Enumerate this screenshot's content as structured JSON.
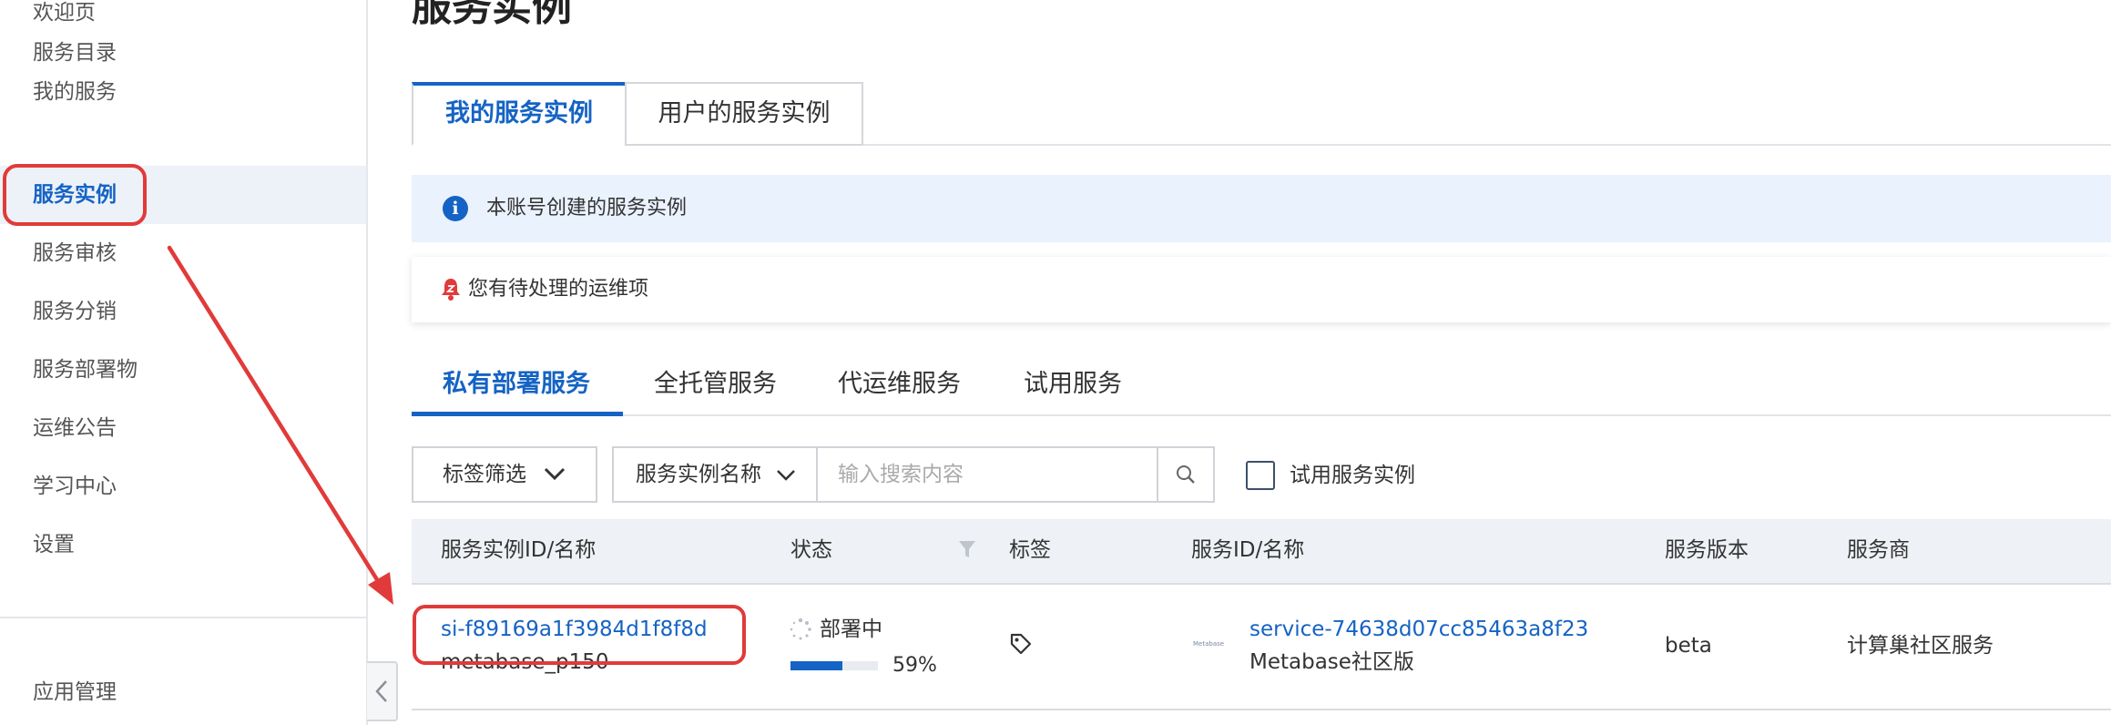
{
  "sidebar": {
    "items": [
      {
        "label": "欢迎页"
      },
      {
        "label": "服务目录"
      },
      {
        "label": "我的服务"
      },
      {
        "label": "服务实例",
        "active": true
      },
      {
        "label": "服务审核"
      },
      {
        "label": "服务分销"
      },
      {
        "label": "服务部署物"
      },
      {
        "label": "运维公告"
      },
      {
        "label": "学习中心"
      },
      {
        "label": "设置"
      }
    ],
    "bottom_item": "应用管理",
    "collapse_icon": "chevron-left-icon"
  },
  "page": {
    "title": "服务实例"
  },
  "top_tabs": [
    {
      "label": "我的服务实例",
      "active": true
    },
    {
      "label": "用户的服务实例"
    }
  ],
  "info_banner": {
    "icon": "info-icon",
    "icon_glyph": "i",
    "text": "本账号创建的服务实例"
  },
  "pending_notice": {
    "icon": "bell-icon",
    "text": "您有待处理的运维项"
  },
  "sub_tabs": [
    {
      "label": "私有部署服务",
      "active": true
    },
    {
      "label": "全托管服务"
    },
    {
      "label": "代运维服务"
    },
    {
      "label": "试用服务"
    }
  ],
  "filters": {
    "tag_filter_label": "标签筛选",
    "search_field_label": "服务实例名称",
    "search_placeholder": "输入搜索内容",
    "trial_checkbox_label": "试用服务实例",
    "trial_checked": false
  },
  "table": {
    "columns": [
      "服务实例ID/名称",
      "状态",
      "标签",
      "服务ID/名称",
      "服务版本",
      "服务商"
    ],
    "rows": [
      {
        "instance_id": "si-f89169a1f3984d1f8f8d",
        "instance_name": "metabase_p150",
        "status": "部署中",
        "progress": 0.59,
        "progress_label": "59%",
        "service_logo_text": "Metabase",
        "service_id": "service-74638d07cc85463a8f23",
        "service_name": "Metabase社区版",
        "version": "beta",
        "provider": "计算巢社区服务"
      }
    ]
  },
  "colors": {
    "accent": "#1563c4",
    "annotation": "#e13a3a",
    "banner_bg": "#eaf2fd",
    "header_bg": "#eef1f5"
  }
}
